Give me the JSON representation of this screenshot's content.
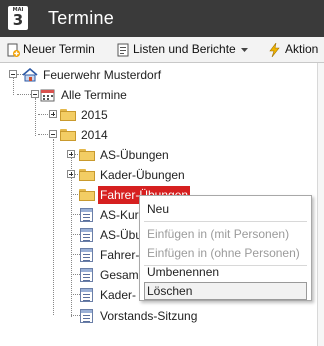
{
  "app": {
    "title": "Termine",
    "icon_month": "MAI",
    "icon_day": "3"
  },
  "toolbar": {
    "new_label": "Neuer Termin",
    "lists_label": "Listen und Berichte",
    "actions_label": "Aktion"
  },
  "tree": {
    "root": "Feuerwehr Musterdorf",
    "all": "Alle Termine",
    "y2015": "2015",
    "y2014": "2014",
    "items": [
      "AS-Übungen",
      "Kader-Übungen",
      "Fahrer-Übungen",
      "AS-Kurs",
      "AS-Übungen",
      "Fahrer-",
      "Gesam",
      "Kader-",
      "Vorstands-Sitzung"
    ]
  },
  "context_menu": {
    "items": [
      "Neu",
      "Einfügen in (mit Personen)",
      "Einfügen in (ohne Personen)",
      "Umbenennen",
      "Löschen"
    ]
  },
  "colors": {
    "titlebar": "#3a3a3a",
    "selection": "#d62020",
    "folder": "#f3cd64"
  }
}
